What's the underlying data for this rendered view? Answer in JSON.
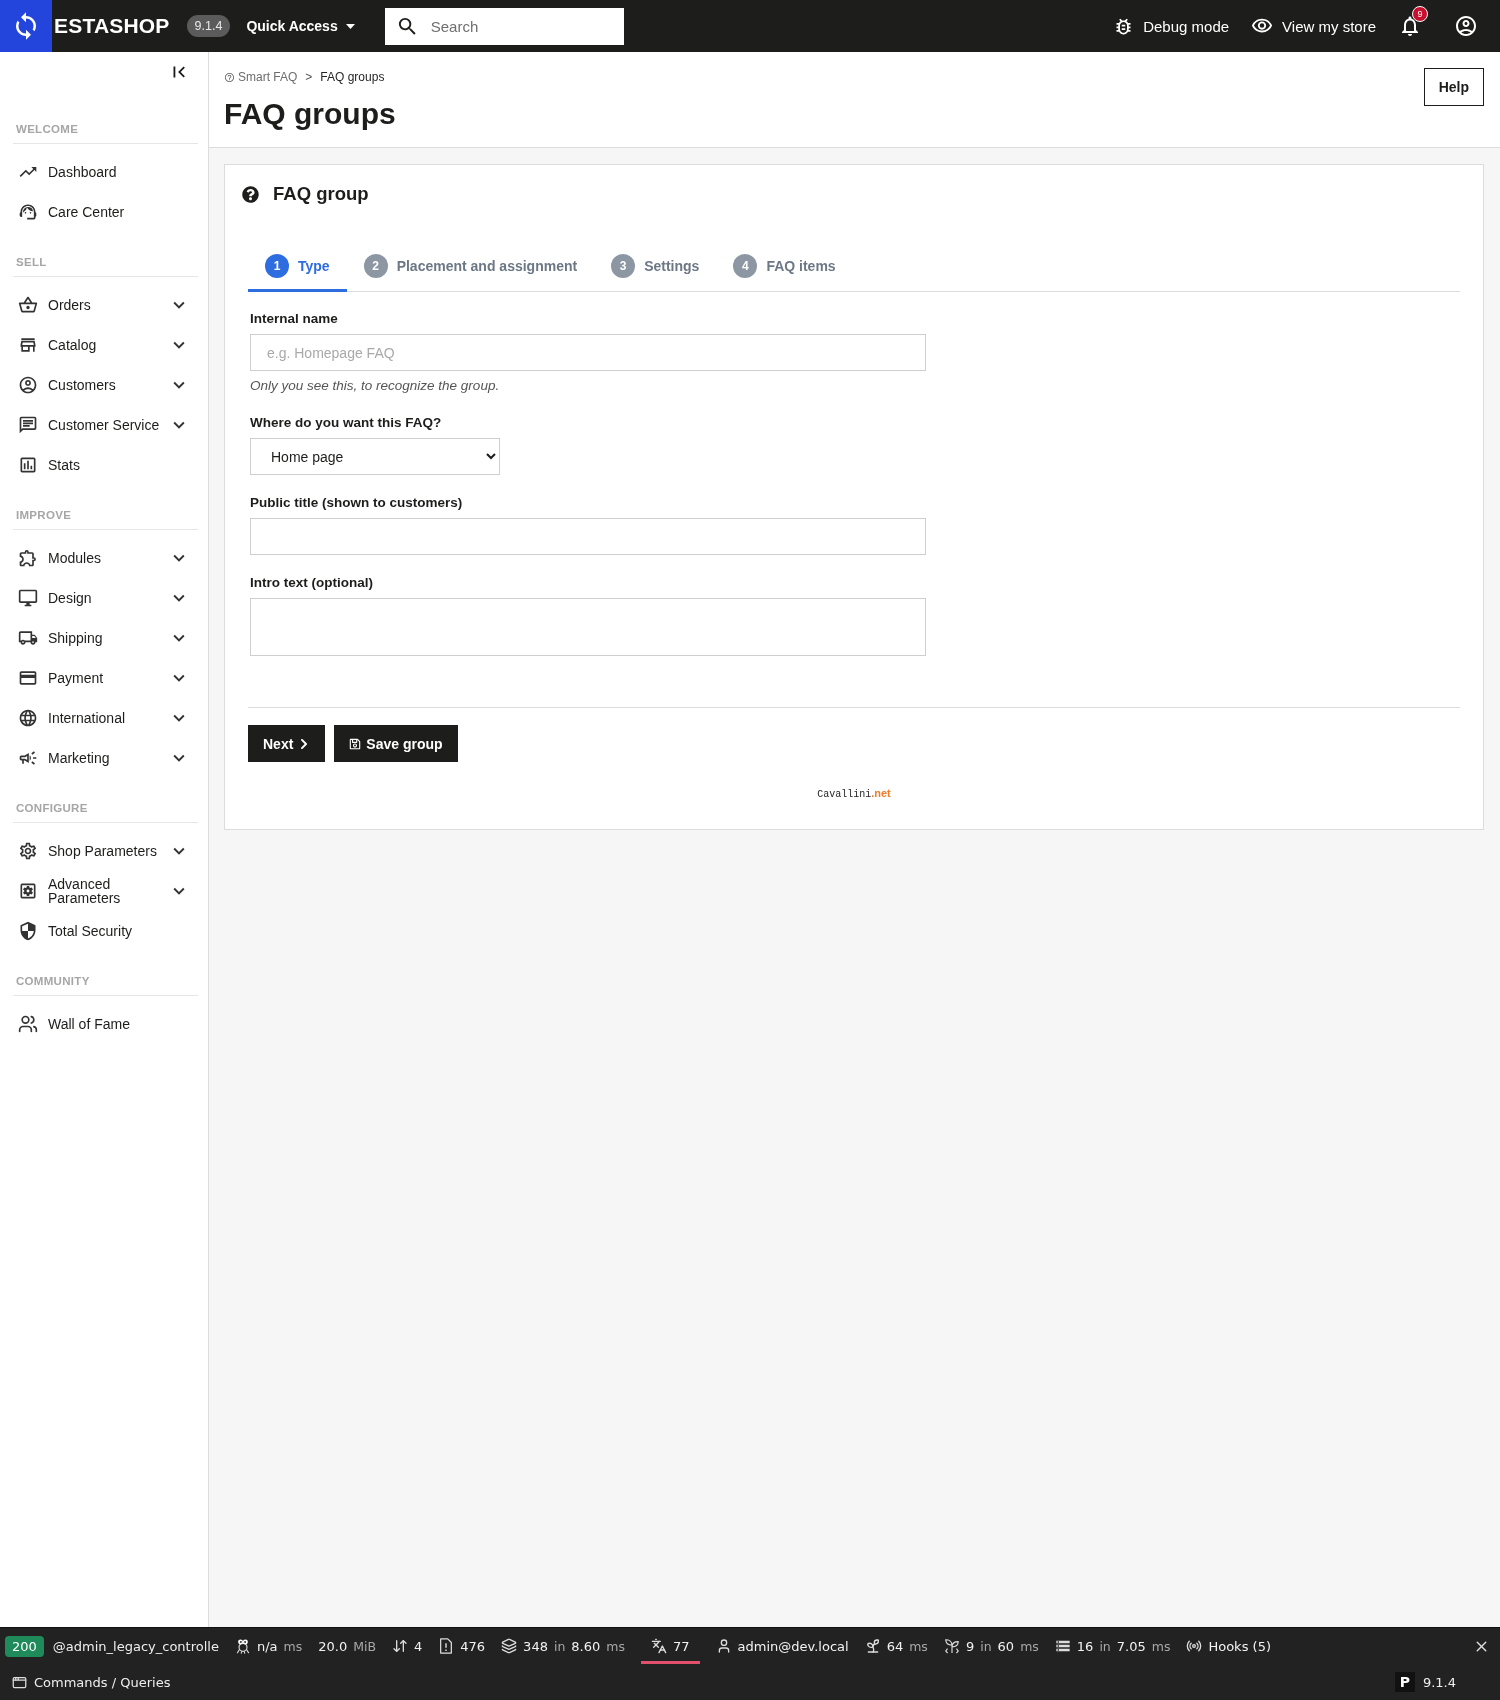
{
  "topbar": {
    "logo_text": "ESTASHOP",
    "version": "9.1.4",
    "quick_access": "Quick Access",
    "search": {
      "placeholder": "Search"
    },
    "debug_mode": "Debug mode",
    "view_store": "View my store",
    "notification_count": "9"
  },
  "sidebar": {
    "sections": [
      {
        "title": "WELCOME",
        "items": [
          {
            "kind": "dashboard",
            "label": "Dashboard",
            "submenu": false
          },
          {
            "kind": "care",
            "label": "Care Center",
            "submenu": false
          }
        ]
      },
      {
        "title": "SELL",
        "items": [
          {
            "kind": "orders",
            "label": "Orders",
            "submenu": true
          },
          {
            "kind": "catalog",
            "label": "Catalog",
            "submenu": true
          },
          {
            "kind": "customers",
            "label": "Customers",
            "submenu": true
          },
          {
            "kind": "service",
            "label": "Customer Service",
            "submenu": true
          },
          {
            "kind": "stats",
            "label": "Stats",
            "submenu": false
          }
        ]
      },
      {
        "title": "IMPROVE",
        "items": [
          {
            "kind": "modules",
            "label": "Modules",
            "submenu": true
          },
          {
            "kind": "design",
            "label": "Design",
            "submenu": true
          },
          {
            "kind": "shipping",
            "label": "Shipping",
            "submenu": true
          },
          {
            "kind": "payment",
            "label": "Payment",
            "submenu": true
          },
          {
            "kind": "international",
            "label": "International",
            "submenu": true
          },
          {
            "kind": "marketing",
            "label": "Marketing",
            "submenu": true
          }
        ]
      },
      {
        "title": "CONFIGURE",
        "items": [
          {
            "kind": "shop",
            "label": "Shop Parameters",
            "submenu": true
          },
          {
            "kind": "advanced",
            "label": "Advanced Parameters",
            "submenu": true
          },
          {
            "kind": "security",
            "label": "Total Security",
            "submenu": false
          }
        ]
      },
      {
        "title": "COMMUNITY",
        "items": [
          {
            "kind": "community",
            "label": "Wall of Fame",
            "submenu": false
          }
        ]
      }
    ]
  },
  "header": {
    "breadcrumb": [
      {
        "label": "Smart FAQ",
        "current": false
      },
      {
        "label": "FAQ groups",
        "current": true
      }
    ],
    "breadcrumb_separator": ">",
    "title": "FAQ groups",
    "help_button": "Help"
  },
  "card": {
    "title": "FAQ group",
    "tabs": [
      {
        "number": "1",
        "label": "Type",
        "selected": true
      },
      {
        "number": "2",
        "label": "Placement and assignment",
        "selected": false
      },
      {
        "number": "3",
        "label": "Settings",
        "selected": false
      },
      {
        "number": "4",
        "label": "FAQ items",
        "selected": false
      }
    ],
    "fields": [
      {
        "kind": "text",
        "label": "Internal name",
        "placeholder": "e.g. Homepage FAQ",
        "help": "Only you see this, to recognize the group."
      },
      {
        "kind": "select",
        "label": "Where do you want this FAQ?",
        "value": "Home page"
      },
      {
        "kind": "text",
        "label": "Public title (shown to customers)"
      },
      {
        "kind": "textarea",
        "label": "Intro text (optional)"
      }
    ],
    "buttons": [
      {
        "kind": "next",
        "label": "Next"
      },
      {
        "kind": "save",
        "label": "Save group"
      }
    ],
    "credit": {
      "name": "Cavallini",
      "domain": ".net"
    }
  },
  "debug_bar": {
    "status": "200",
    "route": "@admin_legacy_controlle",
    "items": [
      {
        "kind": "time",
        "flagged": false,
        "parts": [
          {
            "kind": "value",
            "text": "n/a"
          },
          {
            "kind": "unit",
            "text": "ms"
          }
        ]
      },
      {
        "kind": "memory",
        "flagged": false,
        "parts": [
          {
            "kind": "value",
            "text": "20.0"
          },
          {
            "kind": "unit",
            "text": "MiB"
          }
        ]
      },
      {
        "kind": "requests",
        "flagged": false,
        "parts": [
          {
            "kind": "value",
            "text": "4"
          }
        ]
      },
      {
        "kind": "files",
        "flagged": false,
        "parts": [
          {
            "kind": "value",
            "text": "476"
          }
        ]
      },
      {
        "kind": "cache",
        "flagged": false,
        "parts": [
          {
            "kind": "value",
            "text": "348"
          },
          {
            "kind": "unit",
            "text": "in"
          },
          {
            "kind": "value",
            "text": "8.60"
          },
          {
            "kind": "unit",
            "text": "ms"
          }
        ]
      },
      {
        "kind": "translation",
        "flagged": true,
        "parts": [
          {
            "kind": "value",
            "text": "77"
          }
        ]
      },
      {
        "kind": "user",
        "flagged": false,
        "parts": [
          {
            "kind": "value",
            "text": "admin@dev.local"
          }
        ]
      },
      {
        "kind": "twig",
        "flagged": false,
        "parts": [
          {
            "kind": "value",
            "text": "64"
          },
          {
            "kind": "unit",
            "text": "ms"
          }
        ]
      },
      {
        "kind": "events",
        "flagged": false,
        "parts": [
          {
            "kind": "value",
            "text": "9"
          },
          {
            "kind": "unit",
            "text": "in"
          },
          {
            "kind": "value",
            "text": "60"
          },
          {
            "kind": "unit",
            "text": "ms"
          }
        ]
      },
      {
        "kind": "database",
        "flagged": false,
        "parts": [
          {
            "kind": "value",
            "text": "16"
          },
          {
            "kind": "unit",
            "text": "in"
          },
          {
            "kind": "value",
            "text": "7.05"
          },
          {
            "kind": "unit",
            "text": "ms"
          }
        ]
      },
      {
        "kind": "hooks",
        "flagged": false,
        "parts": [
          {
            "kind": "value",
            "text": "Hooks (5)"
          }
        ]
      }
    ],
    "commands": "Commands / Queries",
    "logo_letter": "P",
    "version": "9.1.4"
  }
}
